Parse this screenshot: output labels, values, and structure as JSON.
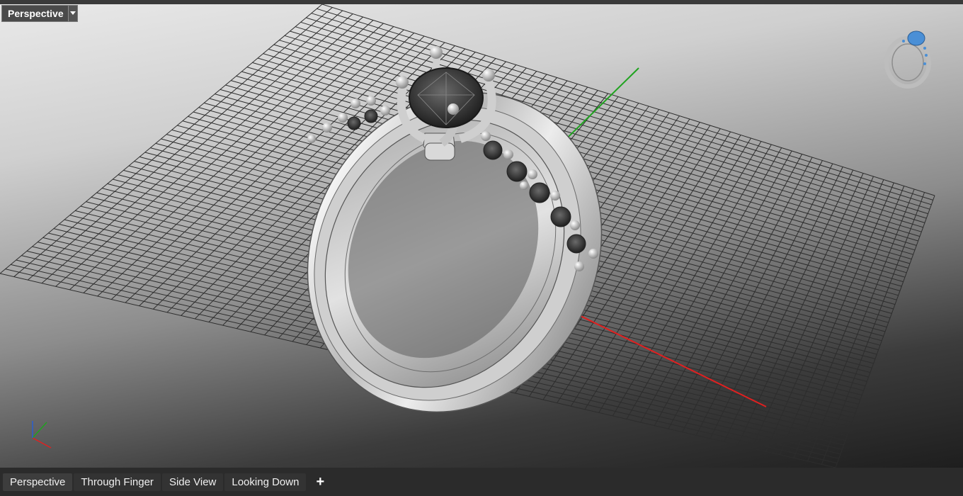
{
  "viewport": {
    "title": "Perspective",
    "colors": {
      "grid": "#2d2d2d",
      "x_axis": "#e02020",
      "y_axis": "#1fa31f",
      "ring_metal": "#d8d8d8",
      "gem": "#3a3a3a",
      "thumb_gem": "#4a8fd6"
    },
    "icons": {
      "dropdown": "caret-down",
      "axes": "world-axes-indicator",
      "thumbnail": "ring-preview-thumbnail"
    }
  },
  "tabs": [
    {
      "label": "Perspective",
      "active": true
    },
    {
      "label": "Through Finger",
      "active": false
    },
    {
      "label": "Side View",
      "active": false
    },
    {
      "label": "Looking Down",
      "active": false
    }
  ],
  "add_tab_label": "+"
}
